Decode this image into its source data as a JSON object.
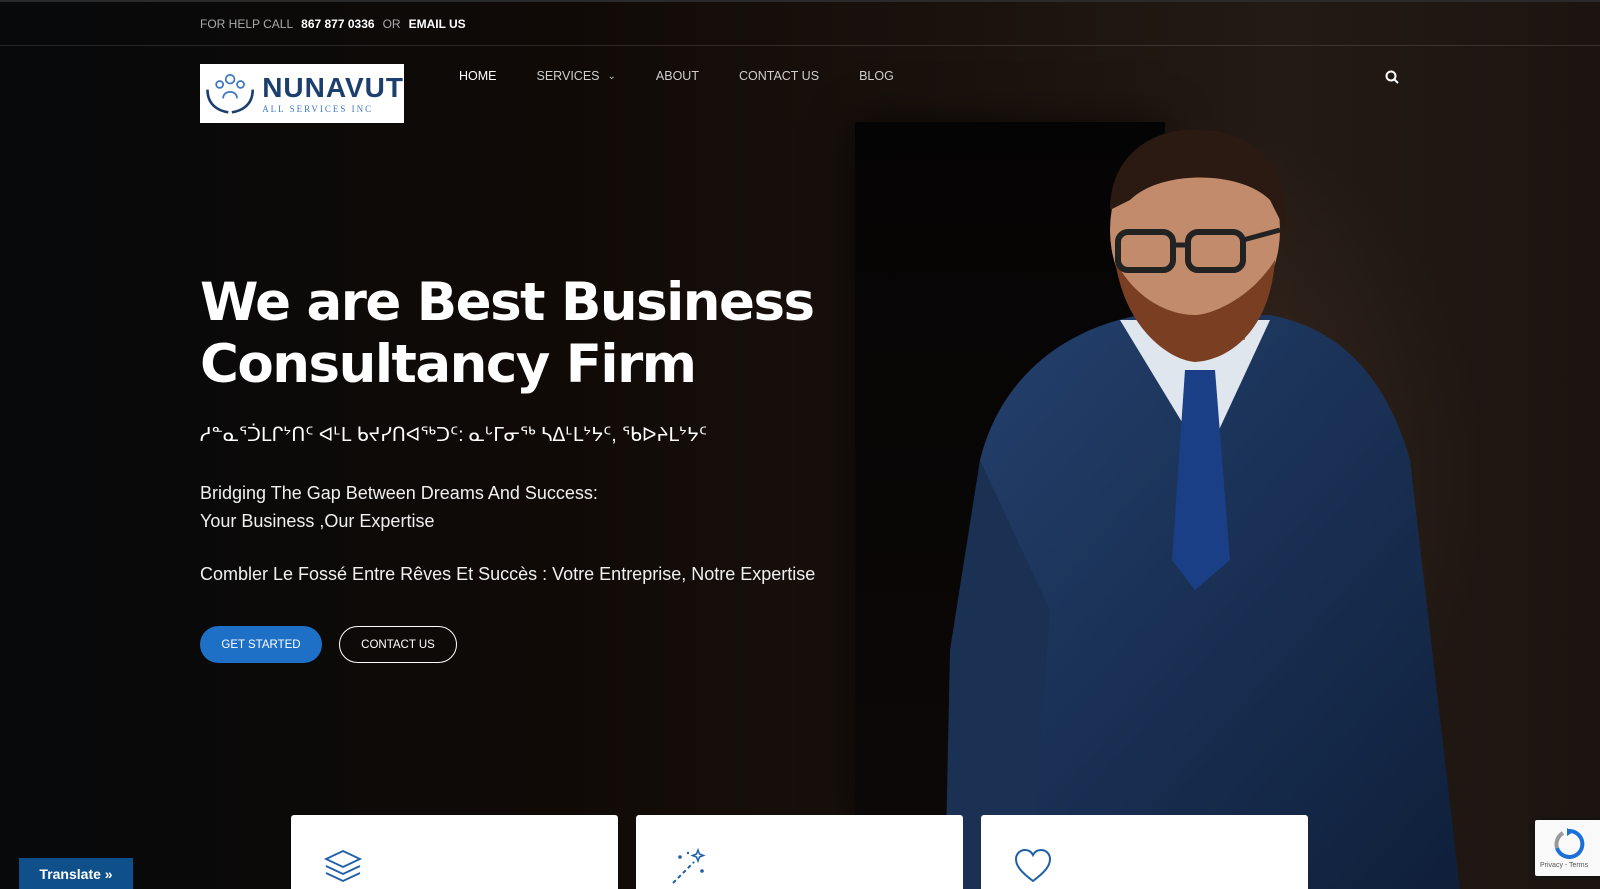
{
  "topbar": {
    "help_label": "FOR HELP CALL",
    "phone": "867 877 0336",
    "or_label": "OR",
    "email_label": "EMAIL US"
  },
  "logo": {
    "title": "NUNAVUT",
    "subtitle": "ALL SERVICES INC"
  },
  "nav": {
    "items": [
      {
        "label": "HOME",
        "active": true
      },
      {
        "label": "SERVICES",
        "has_dropdown": true
      },
      {
        "label": "ABOUT"
      },
      {
        "label": "CONTACT US"
      },
      {
        "label": "BLOG"
      }
    ],
    "search_icon": "search-icon"
  },
  "hero": {
    "headline_line1": "We are Best Business",
    "headline_line2": "Consultancy Firm",
    "syllabics": "ᓱᓐᓇᕐᑑᒪᒋᔾᑎᑦ ᐊᒻᒪ ᑲᔪᓯᑎᐊᖅᑐᑦ: ᓇᒡᒥᓂᖅ ᓴᐃᒻᒪᔾᔭᑦ, ᖃᐅᔨᒪᔾᔭᑦ",
    "tagline_line1": "Bridging The Gap Between Dreams And Success:",
    "tagline_line2": "Your Business ,Our Expertise",
    "tagline_fr": "Combler Le Fossé Entre Rêves Et Succès : Votre Entreprise, Notre Expertise",
    "cta_primary": "GET STARTED",
    "cta_secondary": "CONTACT US"
  },
  "cards": [
    {
      "icon": "layers-icon"
    },
    {
      "icon": "magic-wand-icon"
    },
    {
      "icon": "heart-icon"
    }
  ],
  "translate_widget": {
    "label": "Translate »"
  },
  "recaptcha": {
    "links": "Privacy - Terms"
  },
  "colors": {
    "accent": "#1e70c6",
    "logo_navy": "#1c3f6e",
    "icon_blue": "#1f5fa8",
    "translate_bg": "#10508a"
  }
}
